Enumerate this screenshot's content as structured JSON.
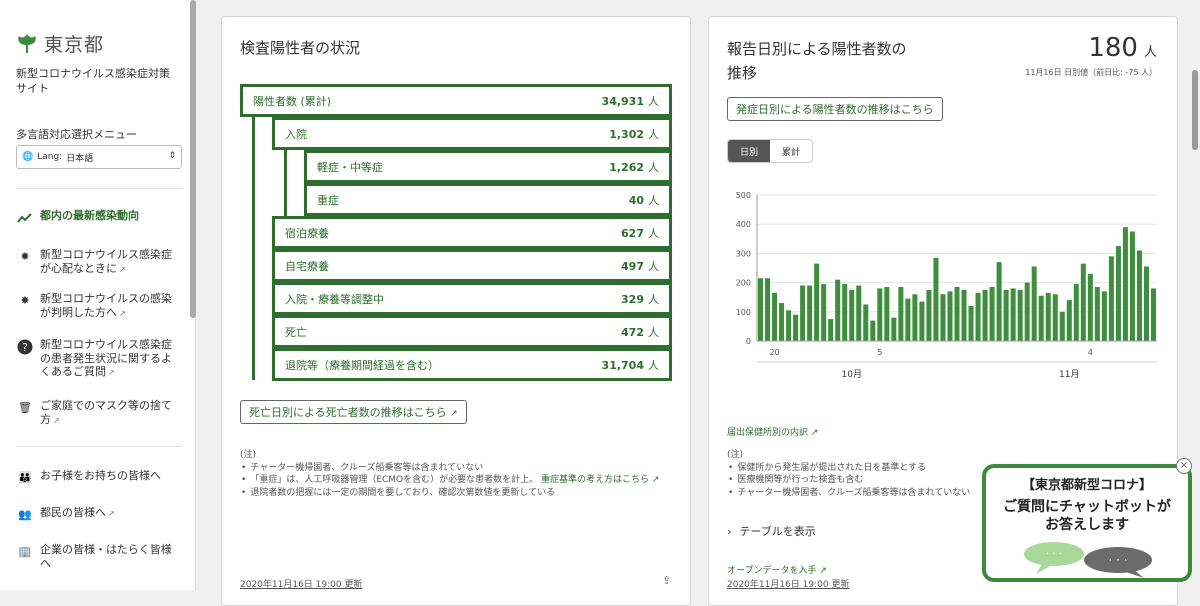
{
  "sidebar": {
    "logo_text": "東京都",
    "site_title": "新型コロナウイルス感染症対策サイト",
    "lang_menu_label": "多言語対応選択メニュー",
    "lang_prefix": "Lang:",
    "lang_value": "日本語",
    "nav": [
      {
        "label": "都内の最新感染動向",
        "icon": "trend-icon",
        "external": false,
        "active": true
      },
      {
        "label": "新型コロナウイルス感染症が心配なときに",
        "icon": "virus-icon",
        "external": true
      },
      {
        "label": "新型コロナウイルスの感染が判明した方へ",
        "icon": "virus-icon",
        "external": true
      },
      {
        "label": "新型コロナウイルス感染症の患者発生状況に関するよくあるご質問",
        "icon": "question-icon",
        "external": true
      },
      {
        "label": "ご家庭でのマスク等の捨て方",
        "icon": "trash-icon",
        "external": true
      },
      {
        "label": "お子様をお持ちの皆様へ",
        "icon": "family-icon",
        "external": false
      },
      {
        "label": "都民の皆様へ",
        "icon": "people-icon",
        "external": true
      },
      {
        "label": "企業の皆様・はたらく皆様へ",
        "icon": "building-icon",
        "external": false
      }
    ]
  },
  "card1": {
    "title": "検査陽性者の状況",
    "rows": [
      {
        "label": "陽性者数 (累計)",
        "value": "34,931",
        "unit": "人"
      },
      {
        "label": "入院",
        "value": "1,302",
        "unit": "人"
      },
      {
        "label": "軽症・中等症",
        "value": "1,262",
        "unit": "人"
      },
      {
        "label": "重症",
        "value": "40",
        "unit": "人"
      },
      {
        "label": "宿泊療養",
        "value": "627",
        "unit": "人"
      },
      {
        "label": "自宅療養",
        "value": "497",
        "unit": "人"
      },
      {
        "label": "入院・療養等調整中",
        "value": "329",
        "unit": "人"
      },
      {
        "label": "死亡",
        "value": "472",
        "unit": "人"
      },
      {
        "label": "退院等（療養期間経過を含む）",
        "value": "31,704",
        "unit": "人"
      }
    ],
    "death_button": "死亡日別による死亡者数の推移はこちら",
    "notes_head": "(注)",
    "note1": "チャーター機帰国者、クルーズ船乗客等は含まれていない",
    "note2_text": "「重症」は、人工呼吸器管理（ECMOを含む）が必要な患者数を計上。",
    "note2_link": "重症基準の考え方はこちら",
    "note3": "退院者数の把握には一定の期間を要しており、確認次第数値を更新している",
    "updated": "2020年11月16日 19:00 更新"
  },
  "card2": {
    "title_line1": "報告日別による陽性者数の",
    "title_line2": "推移",
    "big_value": "180",
    "big_unit": "人",
    "sub_value": "11月16日 日別値（前日比: -75 人）",
    "onset_button": "発症日別による陽性者数の推移はこちら",
    "toggle_daily": "日別",
    "toggle_cumulative": "累計",
    "health_center_link": "届出保健所別の内訳",
    "notes_head": "(注)",
    "note1": "保健所から発生届が提出された日を基準とする",
    "note2": "医療機関等が行った検査も含む",
    "note3": "チャーター機帰国者、クルーズ船乗客等は含まれていない",
    "table_toggle": "テーブルを表示",
    "opendata_link": "オープンデータを入手",
    "updated": "2020年11月16日 19:00 更新"
  },
  "chart_data": {
    "type": "bar",
    "title": "",
    "xlabel": "",
    "ylabel": "",
    "ylim": [
      0,
      500
    ],
    "yticks": [
      0,
      100,
      200,
      300,
      400,
      500
    ],
    "x_tick_labels": [
      {
        "index": 2,
        "label": "20"
      },
      {
        "index": 17,
        "label": "5"
      },
      {
        "index": 47,
        "label": "4"
      }
    ],
    "month_labels": [
      {
        "index": 13,
        "label": "10月"
      },
      {
        "index": 44,
        "label": "11月"
      }
    ],
    "color": "#3e8e3e",
    "values": [
      215,
      215,
      165,
      130,
      105,
      90,
      190,
      190,
      265,
      195,
      75,
      210,
      195,
      175,
      190,
      125,
      70,
      180,
      185,
      80,
      185,
      145,
      160,
      135,
      175,
      285,
      160,
      170,
      185,
      175,
      120,
      165,
      175,
      185,
      270,
      175,
      180,
      175,
      200,
      255,
      155,
      165,
      160,
      100,
      140,
      195,
      265,
      230,
      185,
      170,
      290,
      325,
      390,
      375,
      310,
      255,
      180
    ]
  },
  "chatbot": {
    "line1": "【東京都新型コロナ】",
    "line2": "ご質問にチャットボットが",
    "line3": "お答えします",
    "accent": "#3c8a3c"
  }
}
